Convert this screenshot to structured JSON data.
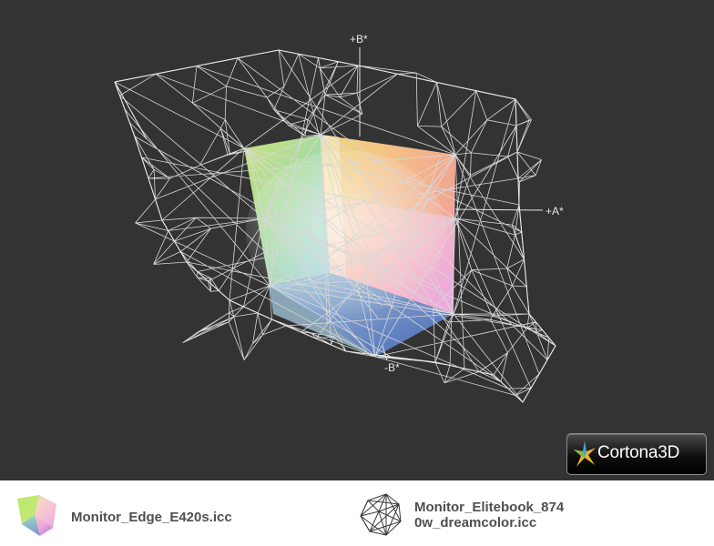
{
  "axes": {
    "b_plus": "+B*",
    "a_plus": "+A*",
    "b_minus": "-B*"
  },
  "branding": {
    "name": "Cortona",
    "suffix": "3D"
  },
  "legend": [
    {
      "label": "Monitor_Edge_E420s.icc",
      "icon": "solid-gamut-icon"
    },
    {
      "label_line1": "Monitor_Elitebook_874",
      "label_line2": "0w_dreamcolor.icc",
      "icon": "wireframe-gamut-icon"
    }
  ],
  "colors": {
    "viewport_background": "#333333",
    "wireframe": "#d8d8d8",
    "legend_text": "#4f4f4f"
  }
}
